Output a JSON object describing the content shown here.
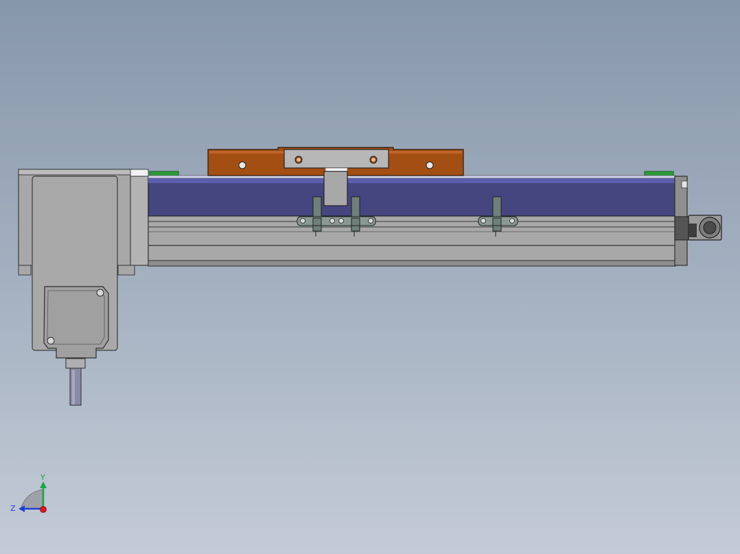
{
  "viewport": {
    "background_top": "#8797aa",
    "background_bottom": "#c4cbd6"
  },
  "model": {
    "motor_color": "#a9a9a9",
    "rail_color": "#454680",
    "carriage_color": "#a34e13",
    "endcap_green": "#2e9c3c",
    "bracket_color": "#6f7f7a",
    "cable_color": "#8a8ca6"
  },
  "triad": {
    "y_label": "Y",
    "z_label": "Z",
    "y_color": "#1aa64a",
    "z_color": "#2240d0",
    "x_color": "#d81b1b"
  }
}
